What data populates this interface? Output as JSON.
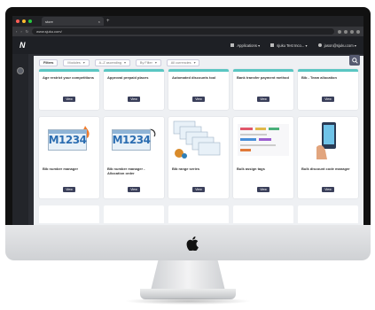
{
  "browser": {
    "tab_title": "store",
    "url": "www.sjuku.com/"
  },
  "app": {
    "logo": "N",
    "applications_label": "Applications",
    "store_label": "sjuku Test Inco...",
    "user_email": "jason@sjuku.com"
  },
  "filters": [
    {
      "label": "Filters",
      "active": true
    },
    {
      "label": "Modules"
    },
    {
      "label": "A–Z ascending"
    },
    {
      "label": "By Filter"
    },
    {
      "label": "All currencies"
    }
  ],
  "row1": [
    {
      "title": "Age restrict your competitions",
      "button": "View"
    },
    {
      "title": "Approval prepaid places",
      "button": "View"
    },
    {
      "title": "Automated discounts tool",
      "button": "View"
    },
    {
      "title": "Bank transfer payment method",
      "button": "View"
    },
    {
      "title": "Bib - Team allocation",
      "button": "View"
    }
  ],
  "row2": [
    {
      "title": "Bib number manager",
      "button": "View",
      "thumb_text": "M1234"
    },
    {
      "title": "Bib number manager - Allocation order",
      "button": "View",
      "thumb_text": "M1234"
    },
    {
      "title": "Bib range series",
      "button": "View"
    },
    {
      "title": "Bulk assign tags",
      "button": "View"
    },
    {
      "title": "Bulk discount code manager",
      "button": "View"
    }
  ],
  "colors": {
    "accent": "#5ac6c2",
    "button": "#3a3f5a",
    "plate_text": "#2b6db1"
  }
}
